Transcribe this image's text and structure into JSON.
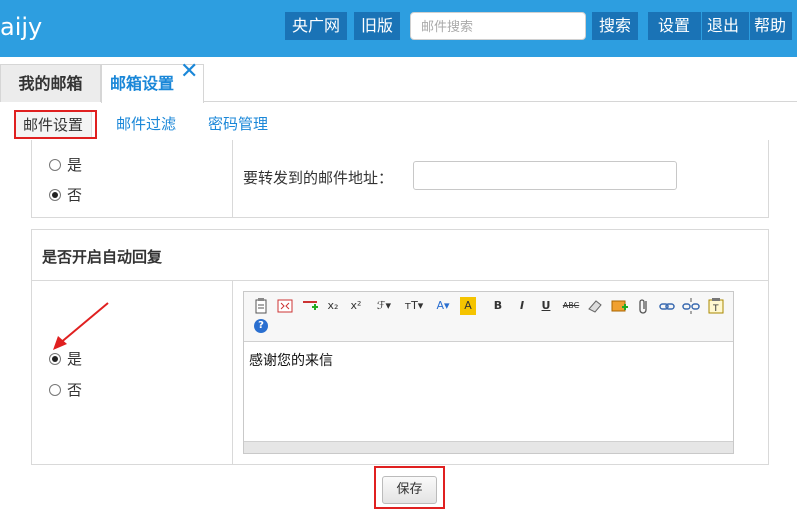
{
  "header": {
    "logo": "aijy",
    "btn_cctv": "央广网",
    "btn_old": "旧版",
    "search_placeholder": "邮件搜索",
    "btn_search": "搜索",
    "btn_settings": "设置",
    "btn_logout": "退出",
    "btn_help": "帮助"
  },
  "tabs": {
    "my_mail": "我的邮箱",
    "mail_settings": "邮箱设置",
    "close": "✕"
  },
  "subtabs": {
    "mail_settings": "邮件设置",
    "mail_filter": "邮件过滤",
    "password": "密码管理"
  },
  "forward": {
    "yes": "是",
    "no": "否",
    "selected": "no",
    "address_label": "要转发到的邮件地址：",
    "address_value": ""
  },
  "auto_reply": {
    "title": "是否开启自动回复",
    "yes": "是",
    "no": "否",
    "selected": "yes",
    "content": "感谢您的来信"
  },
  "editor_icons": [
    "paste-icon",
    "fullscreen-icon",
    "insert-icon",
    "subscript-icon",
    "superscript-icon",
    "font-family-icon",
    "font-size-icon",
    "font-color-icon",
    "highlight-icon",
    "bold-icon",
    "italic-icon",
    "underline-icon",
    "strikethrough-icon",
    "eraser-icon",
    "image-icon",
    "attachment-icon",
    "link-icon",
    "unlink-icon",
    "template-icon",
    "help-icon"
  ],
  "editor_glyphs": {
    "subscript": "x₂",
    "superscript": "x²",
    "font": "ℱ▾",
    "size": "тT▾",
    "color": "A▾",
    "highlight": "A",
    "bold": "B",
    "italic": "I",
    "underline": "U",
    "strike": "ABC",
    "help": "?"
  },
  "save_label": "保存",
  "colors": {
    "header": "#2d9ee0",
    "accent": "#1a87d8",
    "highlight_box": "#e02020"
  }
}
